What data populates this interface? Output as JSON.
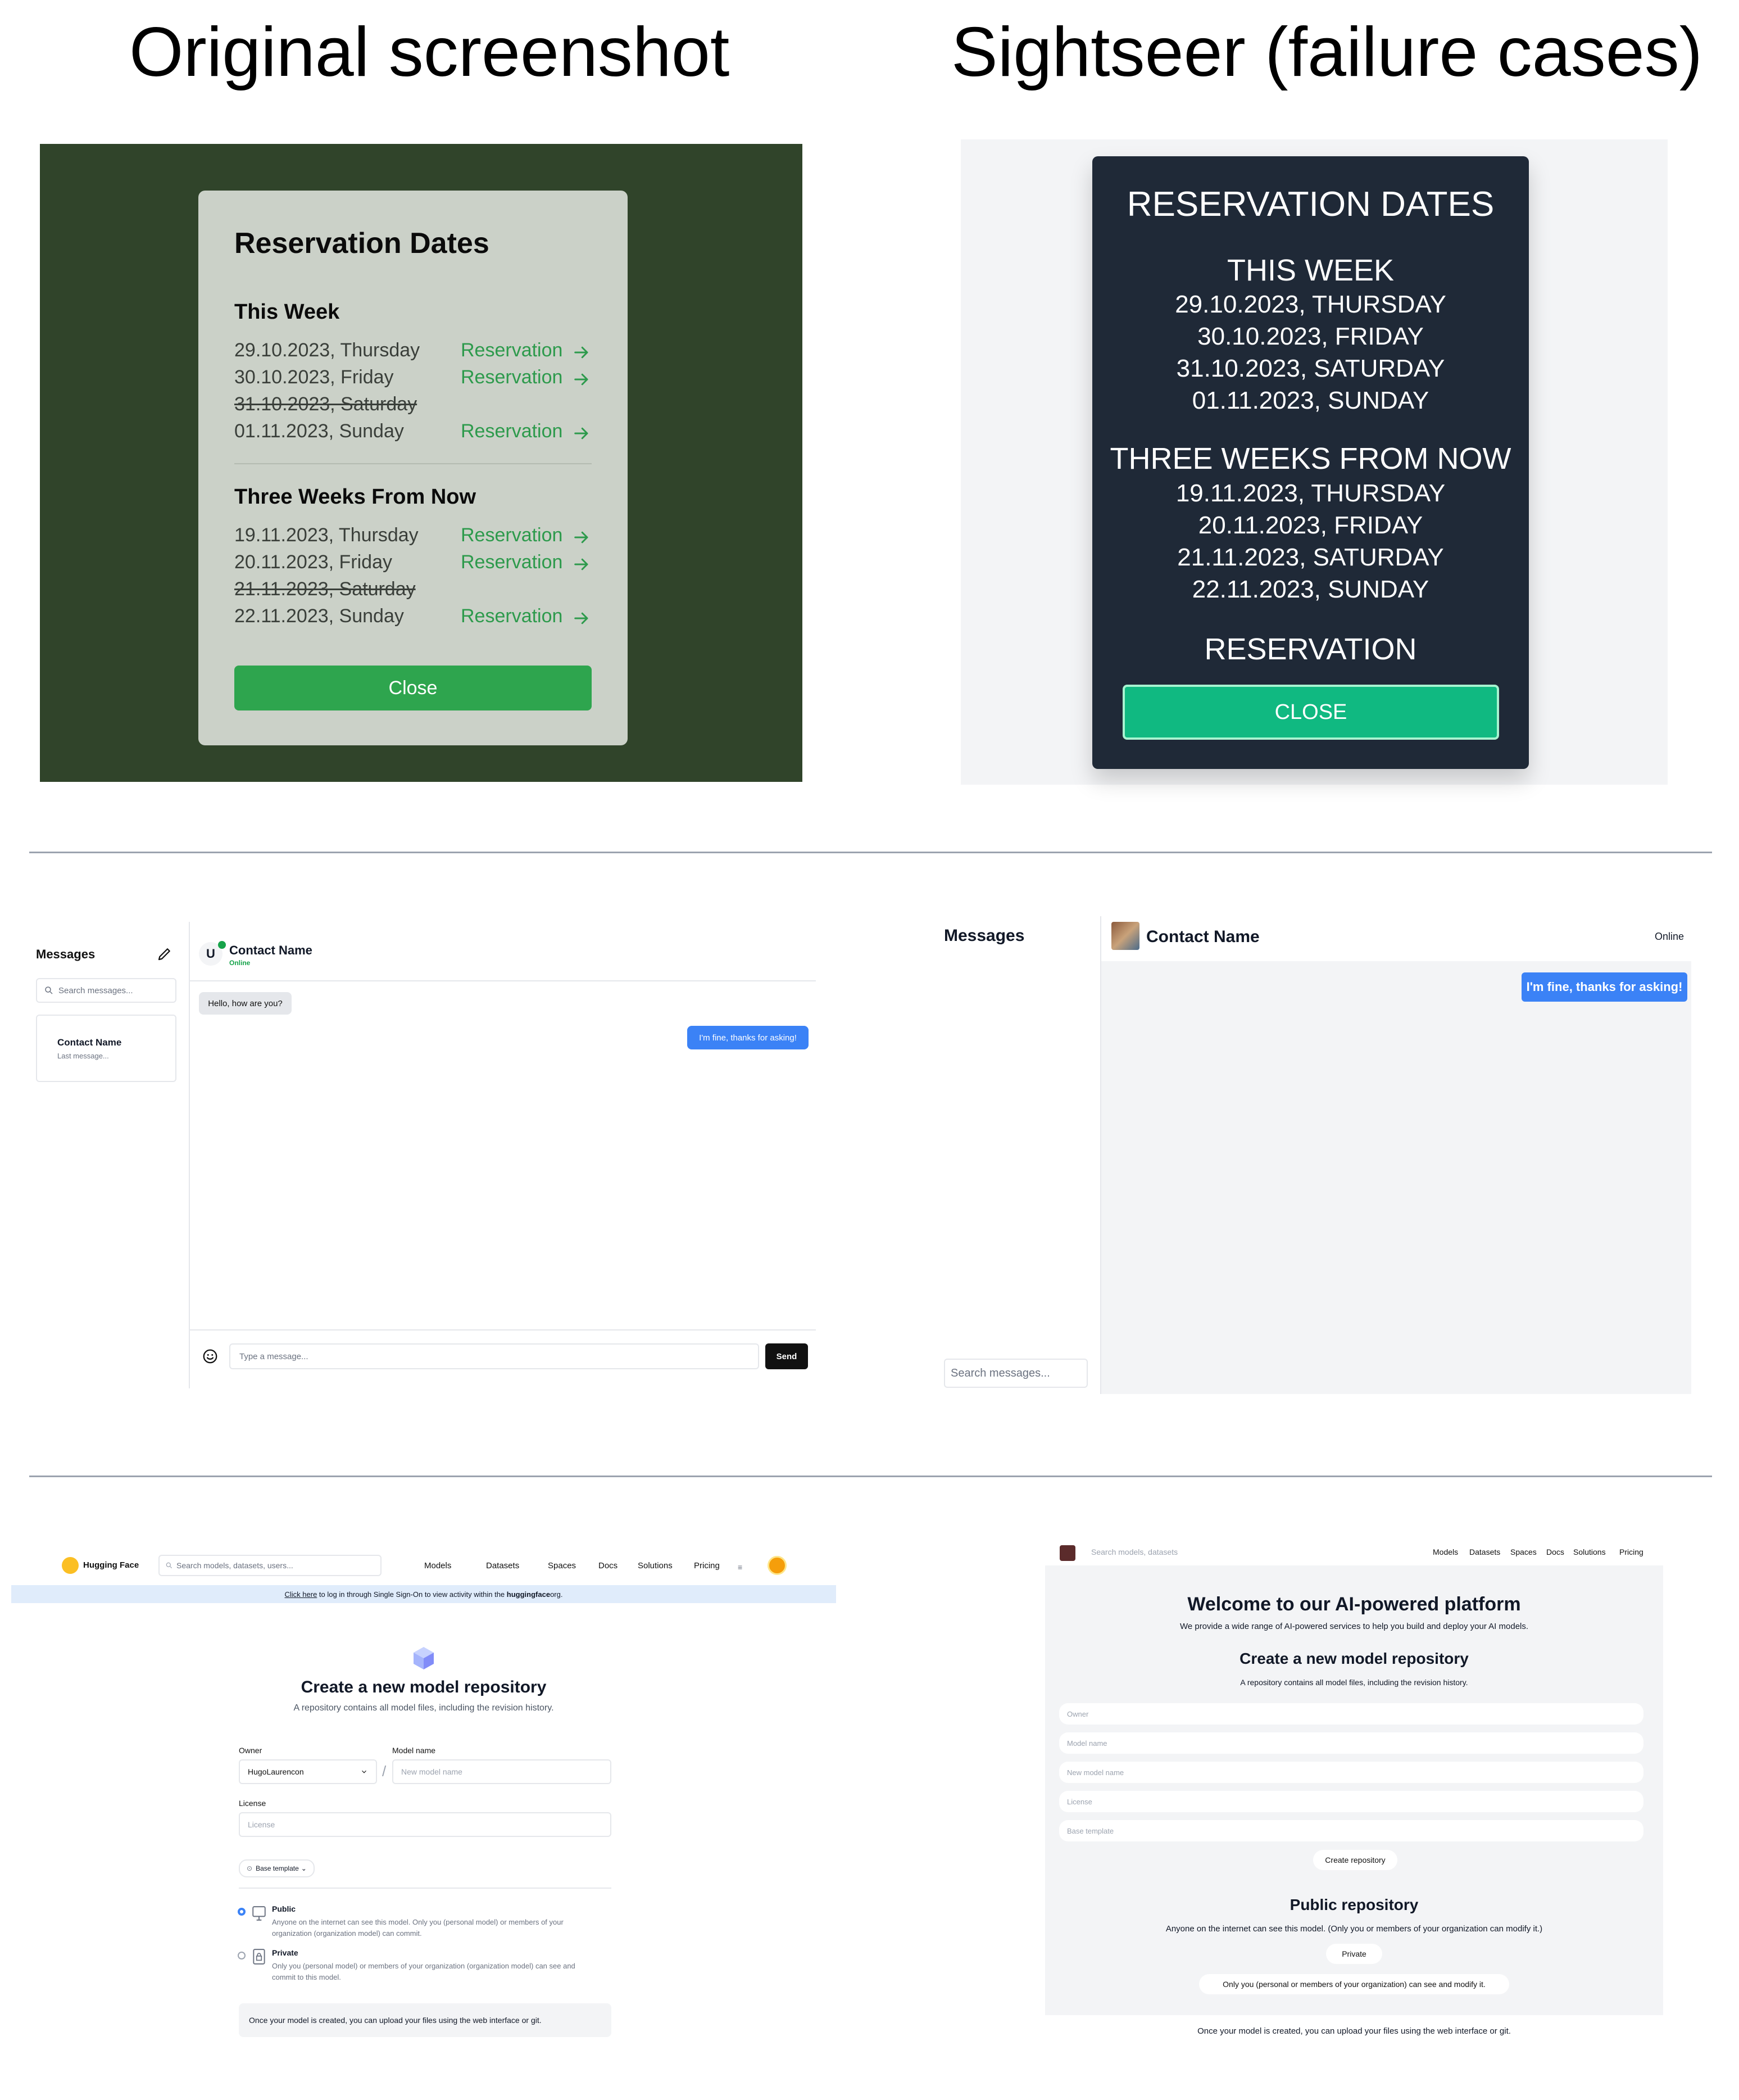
{
  "headers": {
    "original": "Original screenshot",
    "sightseer": "Sightseer (failure cases)"
  },
  "row1_original": {
    "title": "Reservation Dates",
    "this_week": "This Week",
    "three_weeks": "Three Weeks From Now",
    "link_label": "Reservation",
    "week1": [
      {
        "date": "29.10.2023, Thursday",
        "struck": false
      },
      {
        "date": "30.10.2023, Friday",
        "struck": false
      },
      {
        "date": "31.10.2023, Saturday",
        "struck": true
      },
      {
        "date": "01.11.2023, Sunday",
        "struck": false
      }
    ],
    "week2": [
      {
        "date": "19.11.2023, Thursday",
        "struck": false
      },
      {
        "date": "20.11.2023, Friday",
        "struck": false
      },
      {
        "date": "21.11.2023, Saturday",
        "struck": true
      },
      {
        "date": "22.11.2023, Sunday",
        "struck": false
      }
    ],
    "close": "Close",
    "colors": {
      "background": "#30442a",
      "card": "#cbd1c8",
      "link": "#2d9a4c",
      "button": "#2ea54e"
    }
  },
  "row1_sightseer": {
    "title": "RESERVATION DATES",
    "this_week": "THIS WEEK",
    "week1": [
      "29.10.2023, THURSDAY",
      "30.10.2023, FRIDAY",
      "31.10.2023, SATURDAY",
      "01.11.2023, SUNDAY"
    ],
    "three_weeks": "THREE WEEKS FROM NOW",
    "week2": [
      "19.11.2023, THURSDAY",
      "20.11.2023, FRIDAY",
      "21.11.2023, SATURDAY",
      "22.11.2023, SUNDAY"
    ],
    "reservation": "RESERVATION",
    "close": "CLOSE",
    "colors": {
      "card": "#1f2937",
      "button": "#10b981"
    }
  },
  "row2_original": {
    "messages_title": "Messages",
    "search_placeholder": "Search messages...",
    "contact_name": "Contact Name",
    "last_message": "Last message...",
    "avatar_initial": "U",
    "header_name": "Contact Name",
    "status": "Online",
    "incoming": "Hello, how are you?",
    "outgoing": "I'm fine, thanks for asking!",
    "compose_placeholder": "Type a message...",
    "send": "Send"
  },
  "row2_sightseer": {
    "messages_title": "Messages",
    "header_name": "Contact Name",
    "status": "Online",
    "outgoing": "I'm fine, thanks for asking!",
    "search_placeholder": "Search messages..."
  },
  "row3_original": {
    "brand": "Hugging Face",
    "search_placeholder": "Search models, datasets, users...",
    "nav": [
      "Models",
      "Datasets",
      "Spaces",
      "Docs",
      "Solutions",
      "Pricing"
    ],
    "banner_link": "Click here",
    "banner_mid": " to log in through Single Sign-On to view activity within the ",
    "banner_org": "huggingface",
    "banner_end": " org.",
    "heading": "Create a new model repository",
    "subheading": "A repository contains all model files, including the revision history.",
    "owner_label": "Owner",
    "owner_value": "HugoLaurencon",
    "model_label": "Model name",
    "model_placeholder": "New model name",
    "license_label": "License",
    "license_placeholder": "License",
    "base_template": "Base template",
    "public_title": "Public",
    "public_desc": "Anyone on the internet can see this model. Only you (personal model) or members of your organization (organization model) can commit.",
    "private_title": "Private",
    "private_desc": "Only you (personal model) or members of your organization (organization model) can see and commit to this model.",
    "footer_note": "Once your model is created, you can upload your files using the web interface or git."
  },
  "row3_sightseer": {
    "search_placeholder": "Search models, datasets",
    "nav": [
      "Models",
      "Datasets",
      "Spaces",
      "Docs",
      "Solutions",
      "Pricing"
    ],
    "welcome": "Welcome to our AI-powered platform",
    "welcome_sub": "We provide a wide range of AI-powered services to help you build and deploy your AI models.",
    "heading": "Create a new model repository",
    "subheading": "A repository contains all model files, including the revision history.",
    "fields": [
      "Owner",
      "Model name",
      "New model name",
      "License",
      "Base template"
    ],
    "create_button": "Create repository",
    "public_heading": "Public repository",
    "public_desc": "Anyone on the internet can see this model. (Only you or members of your organization can modify it.)",
    "private_button": "Private",
    "private_desc": "Only you (personal or members of your organization) can see and modify it.",
    "footer_note": "Once your model is created, you can upload your files using the web interface or git."
  }
}
